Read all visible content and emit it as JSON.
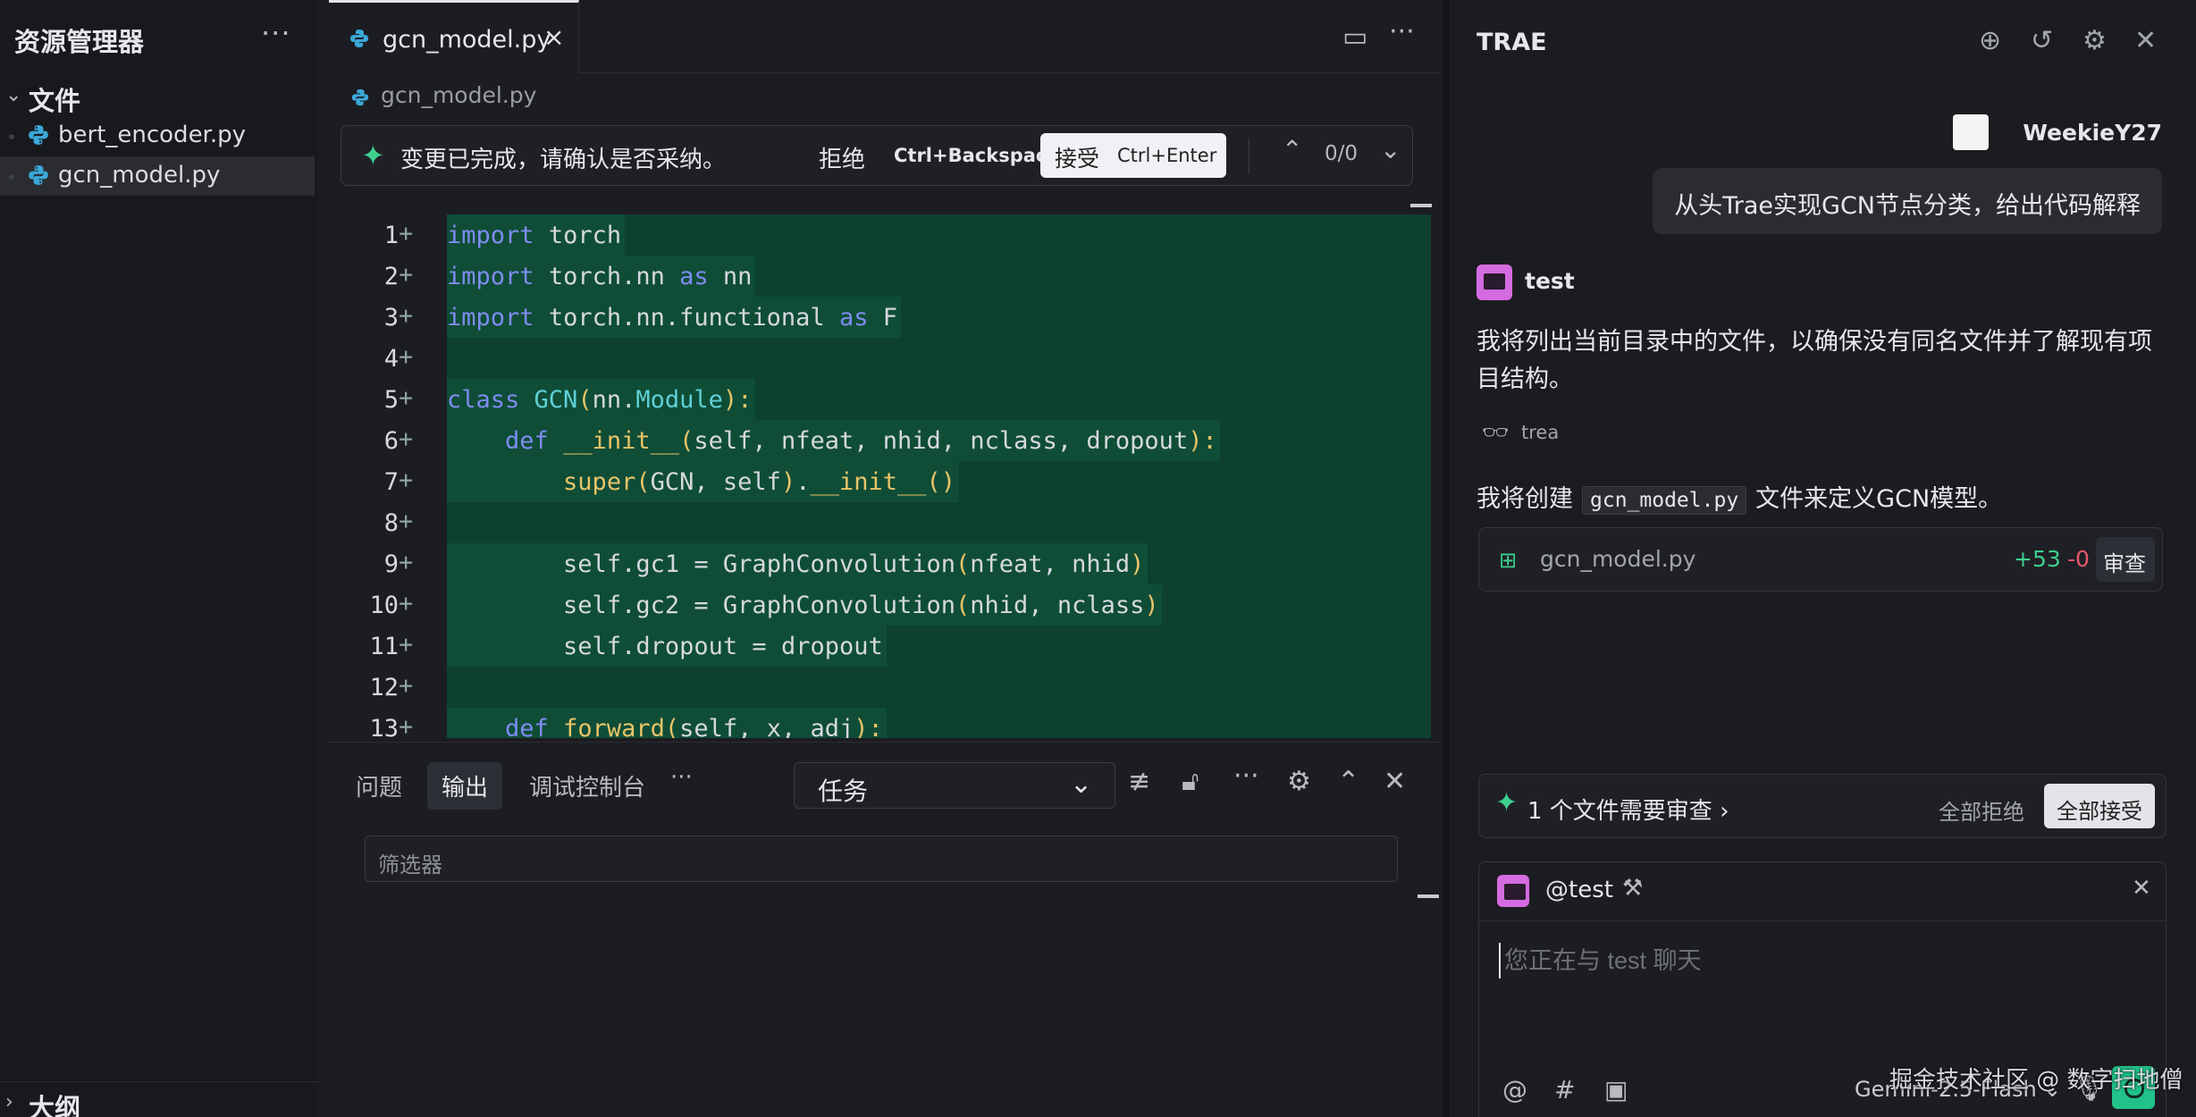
{
  "explorer": {
    "title": "资源管理器",
    "more": "···",
    "section": "文件",
    "files": [
      {
        "name": "bert_encoder.py",
        "active": false
      },
      {
        "name": "gcn_model.py",
        "active": true
      }
    ],
    "outline": "大纲"
  },
  "editor": {
    "tab": {
      "name": "gcn_model.py",
      "close": "×"
    },
    "breadcrumb": "gcn_model.py",
    "review": {
      "message": "变更已完成，请确认是否采纳。",
      "reject_label": "拒绝",
      "reject_key": "Ctrl+Backspace",
      "accept_label": "接受",
      "accept_key": "Ctrl+Enter",
      "count": "0/0"
    },
    "lines": [
      {
        "n": "1",
        "text": "import torch"
      },
      {
        "n": "2",
        "text": "import torch.nn as nn"
      },
      {
        "n": "3",
        "text": "import torch.nn.functional as F"
      },
      {
        "n": "4",
        "text": ""
      },
      {
        "n": "5",
        "text": "class GCN(nn.Module):"
      },
      {
        "n": "6",
        "text": "    def __init__(self, nfeat, nhid, nclass, dropout):"
      },
      {
        "n": "7",
        "text": "        super(GCN, self).__init__()"
      },
      {
        "n": "8",
        "text": ""
      },
      {
        "n": "9",
        "text": "        self.gc1 = GraphConvolution(nfeat, nhid)"
      },
      {
        "n": "10",
        "text": "        self.gc2 = GraphConvolution(nhid, nclass)"
      },
      {
        "n": "11",
        "text": "        self.dropout = dropout"
      },
      {
        "n": "12",
        "text": ""
      },
      {
        "n": "13",
        "text": "    def forward(self, x, adj):"
      }
    ]
  },
  "panel": {
    "tabs": [
      "问题",
      "输出",
      "调试控制台",
      "···"
    ],
    "active_tab": "输出",
    "task_value": "任务",
    "filter_placeholder": "筛选器"
  },
  "chat": {
    "title": "TRAE",
    "user_name": "WeekieY27",
    "user_message": "从头Trae实现GCN节点分类，给出代码解释",
    "bot_name": "test",
    "bot_text": "我将列出当前目录中的文件，以确保没有同名文件并了解现有项目结构。",
    "tool_name": "trea",
    "create_prefix": "我将创建",
    "create_code": "gcn_model.py",
    "create_suffix": "文件来定义GCN模型。",
    "file_card": {
      "name": "gcn_model.py",
      "added": "+53",
      "removed": "-0",
      "review": "审查"
    },
    "pending": {
      "text": "1 个文件需要审查",
      "chevron": "›",
      "reject_all": "全部拒绝",
      "accept_all": "全部接受"
    },
    "input": {
      "mention": "@test",
      "placeholder": "您正在与 test 聊天",
      "model": "Gemini-2.5-Flash ⌄"
    }
  },
  "watermark": "掘金技术社区 @ 数字扫地僧",
  "colors": {
    "accent_green": "#3ecf8e",
    "diff_bg": "#0d4030",
    "keyword": "#7f8cf0"
  }
}
